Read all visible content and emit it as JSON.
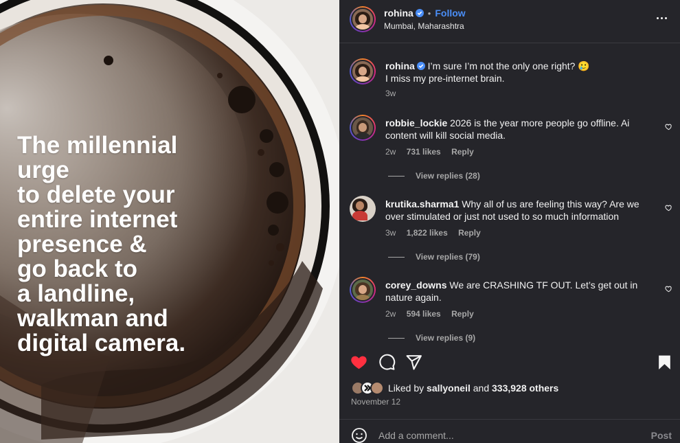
{
  "post_image": {
    "caption_lines": [
      "The millennial",
      "urge",
      "to delete your",
      "entire internet",
      "presence &",
      "go back to",
      "a landline,",
      "walkman and",
      "digital camera."
    ]
  },
  "header": {
    "username": "rohina",
    "verified": true,
    "follow_label": "Follow",
    "location": "Mumbai, Maharashtra",
    "more_icon": "more-horizontal-icon"
  },
  "caption": {
    "username": "rohina",
    "text_line1": "I’m sure I’m not the only one right? 🥲",
    "text_line2": "I miss my pre-internet brain.",
    "time": "3w"
  },
  "comments": [
    {
      "username": "robbie_lockie",
      "text": "2026 is the year more people go offline. Ai content will kill social media.",
      "time": "2w",
      "likes": "731 likes",
      "reply": "Reply",
      "view_replies": "View replies (28)"
    },
    {
      "username": "krutika.sharma1",
      "text": "Why all of us are feeling this way? Are we over stimulated or just not used to so much information",
      "time": "3w",
      "likes": "1,822 likes",
      "reply": "Reply",
      "view_replies": "View replies (79)"
    },
    {
      "username": "corey_downs",
      "text": "We are CRASHING TF OUT. Let’s get out in nature again.",
      "time": "2w",
      "likes": "594 likes",
      "reply": "Reply",
      "view_replies": "View replies (9)"
    }
  ],
  "actions": {
    "like_icon": "heart-filled-icon",
    "comment_icon": "comment-icon",
    "share_icon": "send-icon",
    "save_icon": "bookmark-filled-icon",
    "like_color": "#ff3040"
  },
  "likes": {
    "prefix": "Liked by",
    "user": "sallyoneil",
    "and": "and",
    "others": "333,928 others"
  },
  "date": "November 12",
  "add_comment": {
    "placeholder": "Add a comment...",
    "post_label": "Post"
  },
  "colors": {
    "panel_bg": "#25252a",
    "accent_link": "#4a8ef7",
    "muted_text": "#a8a8a8"
  }
}
